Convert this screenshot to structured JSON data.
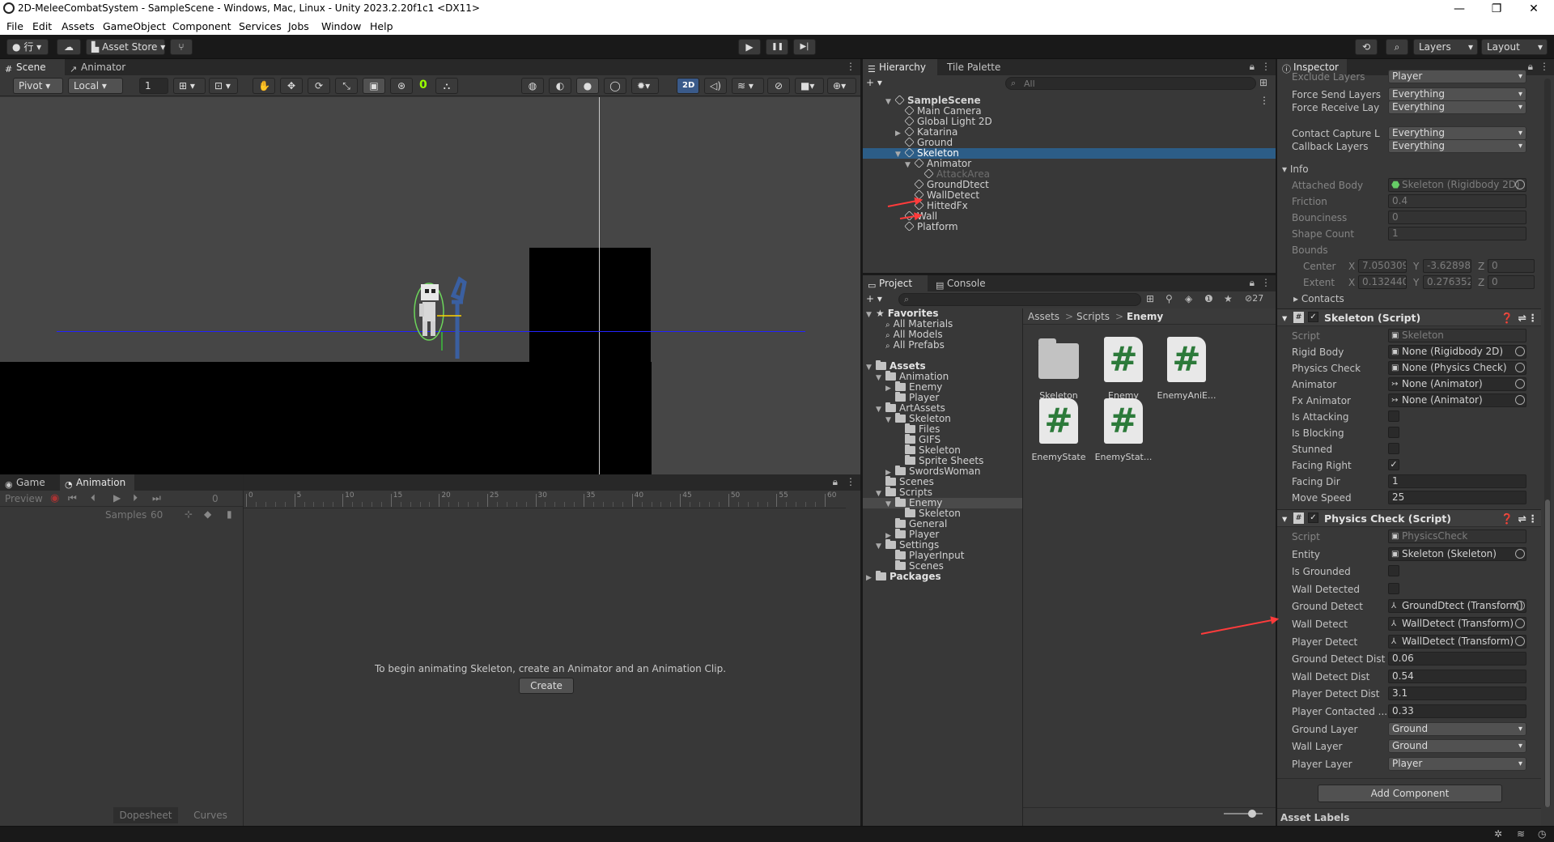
{
  "window": {
    "title": "2D-MeleeCombatSystem - SampleScene - Windows, Mac, Linux - Unity 2023.2.20f1c1 <DX11>",
    "minimize": "—",
    "maximize": "❐",
    "close": "✕"
  },
  "menu": [
    "File",
    "Edit",
    "Assets",
    "GameObject",
    "Component",
    "Services",
    "Jobs",
    "Window",
    "Help"
  ],
  "toolbar": {
    "account_label": "行",
    "asset_store": "Asset Store",
    "play": "▶",
    "pause": "❚❚",
    "step": "▶|",
    "layers": "Layers",
    "layout": "Layout"
  },
  "scene": {
    "tab_scene": "Scene",
    "tab_animator": "Animator",
    "pivot": "Pivot",
    "local": "Local",
    "grid_size": "1",
    "counter": "0",
    "mode_2d": "2D"
  },
  "animation": {
    "tab_game": "Game",
    "tab_animation": "Animation",
    "preview": "Preview",
    "frame": "0",
    "samples_label": "Samples",
    "samples_value": "60",
    "ticks": [
      "0",
      "5",
      "10",
      "15",
      "20",
      "25",
      "30",
      "35",
      "40",
      "45",
      "50",
      "55",
      "60"
    ],
    "message": "To begin animating Skeleton, create an Animator and an Animation Clip.",
    "create_button": "Create",
    "dopesheet": "Dopesheet",
    "curves": "Curves"
  },
  "hierarchy": {
    "tab_hierarchy": "Hierarchy",
    "tab_tile_palette": "Tile Palette",
    "search_placeholder": "All",
    "items": [
      {
        "label": "SampleScene",
        "depth": 0,
        "expanded": true,
        "scene": true
      },
      {
        "label": "Main Camera",
        "depth": 1
      },
      {
        "label": "Global Light 2D",
        "depth": 1
      },
      {
        "label": "Katarina",
        "depth": 1,
        "collapsed": true
      },
      {
        "label": "Ground",
        "depth": 1
      },
      {
        "label": "Skeleton",
        "depth": 1,
        "expanded": true,
        "selected": true
      },
      {
        "label": "Animator",
        "depth": 2,
        "expanded": true
      },
      {
        "label": "AttackArea",
        "depth": 3,
        "dim": true
      },
      {
        "label": "GroundDtect",
        "depth": 2
      },
      {
        "label": "WallDetect",
        "depth": 2
      },
      {
        "label": "HittedFx",
        "depth": 2
      },
      {
        "label": "Wall",
        "depth": 1
      },
      {
        "label": "Platform",
        "depth": 1
      }
    ]
  },
  "project": {
    "tab_project": "Project",
    "tab_console": "Console",
    "hidden_count": "27",
    "breadcrumb": [
      "Assets",
      "Scripts",
      "Enemy"
    ],
    "tree": [
      {
        "label": "Favorites",
        "depth": 0,
        "kind": "star",
        "bold": true,
        "expanded": true
      },
      {
        "label": "All Materials",
        "depth": 1,
        "kind": "search"
      },
      {
        "label": "All Models",
        "depth": 1,
        "kind": "search"
      },
      {
        "label": "All Prefabs",
        "depth": 1,
        "kind": "search"
      },
      {
        "label": "",
        "depth": 0,
        "kind": "gap"
      },
      {
        "label": "Assets",
        "depth": 0,
        "kind": "folder",
        "bold": true,
        "expanded": true
      },
      {
        "label": "Animation",
        "depth": 1,
        "kind": "folder",
        "expanded": true
      },
      {
        "label": "Enemy",
        "depth": 2,
        "kind": "folder",
        "collapsed": true
      },
      {
        "label": "Player",
        "depth": 2,
        "kind": "folder"
      },
      {
        "label": "ArtAssets",
        "depth": 1,
        "kind": "folder",
        "expanded": true
      },
      {
        "label": "Skeleton",
        "depth": 2,
        "kind": "folder",
        "expanded": true
      },
      {
        "label": "Files",
        "depth": 3,
        "kind": "folder"
      },
      {
        "label": "GIFS",
        "depth": 3,
        "kind": "folder"
      },
      {
        "label": "Skeleton",
        "depth": 3,
        "kind": "folder"
      },
      {
        "label": "Sprite Sheets",
        "depth": 3,
        "kind": "folder"
      },
      {
        "label": "SwordsWoman",
        "depth": 2,
        "kind": "folder",
        "collapsed": true
      },
      {
        "label": "Scenes",
        "depth": 1,
        "kind": "folder"
      },
      {
        "label": "Scripts",
        "depth": 1,
        "kind": "folder",
        "expanded": true
      },
      {
        "label": "Enemy",
        "depth": 2,
        "kind": "folder",
        "expanded": true,
        "selected": true
      },
      {
        "label": "Skeleton",
        "depth": 3,
        "kind": "folder"
      },
      {
        "label": "General",
        "depth": 2,
        "kind": "folder"
      },
      {
        "label": "Player",
        "depth": 2,
        "kind": "folder",
        "collapsed": true
      },
      {
        "label": "Settings",
        "depth": 1,
        "kind": "folder",
        "expanded": true
      },
      {
        "label": "PlayerInput",
        "depth": 2,
        "kind": "folder"
      },
      {
        "label": "Scenes",
        "depth": 2,
        "kind": "folder"
      },
      {
        "label": "Packages",
        "depth": 0,
        "kind": "folder",
        "bold": true,
        "collapsed": true
      }
    ],
    "assets": [
      {
        "name": "Skeleton",
        "kind": "folder"
      },
      {
        "name": "Enemy",
        "kind": "script"
      },
      {
        "name": "EnemyAniE...",
        "kind": "script"
      },
      {
        "name": "EnemyState",
        "kind": "script"
      },
      {
        "name": "EnemyStat...",
        "kind": "script"
      }
    ]
  },
  "inspector": {
    "tab": "Inspector",
    "cut_row": {
      "label": "Exclude Layers",
      "value": "Player"
    },
    "layer_rows": [
      {
        "label": "Force Send Layers",
        "value": "Everything"
      },
      {
        "label": "Force Receive Lay",
        "value": "Everything"
      },
      {
        "label": "Contact Capture L",
        "value": "Everything"
      },
      {
        "label": "Callback Layers",
        "value": "Everything"
      }
    ],
    "info": {
      "header": "Info",
      "attached_body_label": "Attached Body",
      "attached_body_value": "Skeleton (Rigidbody 2D)",
      "friction_label": "Friction",
      "friction_value": "0.4",
      "bounciness_label": "Bounciness",
      "bounciness_value": "0",
      "shape_count_label": "Shape Count",
      "shape_count_value": "1",
      "bounds_label": "Bounds",
      "center_label": "Center",
      "center": [
        "7.050309",
        "-3.62898",
        "0"
      ],
      "extent_label": "Extent",
      "extent": [
        "0.1324400",
        "0.276352",
        "0"
      ],
      "contacts": "Contacts"
    },
    "skeleton_script": {
      "title": "Skeleton (Script)",
      "rows": [
        {
          "label": "Script",
          "value": "Skeleton",
          "kind": "obj",
          "dim": true
        },
        {
          "label": "Rigid Body",
          "value": "None (Rigidbody 2D)",
          "kind": "obj"
        },
        {
          "label": "Physics Check",
          "value": "None (Physics Check)",
          "kind": "obj"
        },
        {
          "label": "Animator",
          "value": "None (Animator)",
          "kind": "obj"
        },
        {
          "label": "Fx Animator",
          "value": "None (Animator)",
          "kind": "obj"
        },
        {
          "label": "Is Attacking",
          "value": "",
          "kind": "toggle"
        },
        {
          "label": "Is Blocking",
          "value": "",
          "kind": "toggle"
        },
        {
          "label": "Stunned",
          "value": "",
          "kind": "toggle"
        },
        {
          "label": "Facing Right",
          "value": "✓",
          "kind": "toggle"
        },
        {
          "label": "Facing Dir",
          "value": "1",
          "kind": "text"
        },
        {
          "label": "Move Speed",
          "value": "25",
          "kind": "text"
        }
      ]
    },
    "physics_script": {
      "title": "Physics Check (Script)",
      "rows": [
        {
          "label": "Script",
          "value": "PhysicsCheck",
          "kind": "obj",
          "dim": true
        },
        {
          "label": "Entity",
          "value": "Skeleton (Skeleton)",
          "kind": "obj"
        },
        {
          "label": "Is Grounded",
          "value": "",
          "kind": "toggle"
        },
        {
          "label": "Wall Detected",
          "value": "",
          "kind": "toggle"
        },
        {
          "label": "Ground Detect",
          "value": "GroundDtect (Transform)",
          "kind": "obj"
        },
        {
          "label": "Wall Detect",
          "value": "WallDetect (Transform)",
          "kind": "obj"
        },
        {
          "label": "Player Detect",
          "value": "WallDetect (Transform)",
          "kind": "obj"
        },
        {
          "label": "Ground Detect Dist",
          "value": "0.06",
          "kind": "text"
        },
        {
          "label": "Wall Detect Dist",
          "value": "0.54",
          "kind": "text"
        },
        {
          "label": "Player Detect Dist",
          "value": "3.1",
          "kind": "text"
        },
        {
          "label": "Player Contacted ...",
          "value": "0.33",
          "kind": "text"
        },
        {
          "label": "Ground Layer",
          "value": "Ground",
          "kind": "dropdown"
        },
        {
          "label": "Wall Layer",
          "value": "Ground",
          "kind": "dropdown"
        },
        {
          "label": "Player Layer",
          "value": "Player",
          "kind": "dropdown"
        }
      ]
    },
    "add_component": "Add Component",
    "asset_labels": "Asset Labels"
  }
}
